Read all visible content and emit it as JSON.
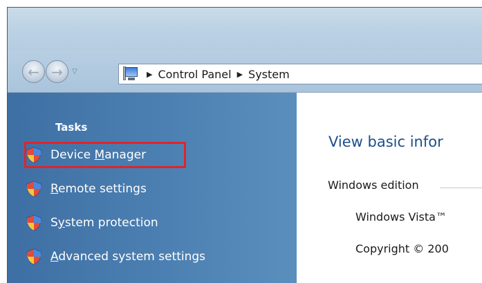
{
  "address_bar": {
    "crumbs": [
      "Control Panel",
      "System"
    ]
  },
  "tasks": {
    "heading": "Tasks",
    "items": [
      {
        "label": "Device Manager",
        "accesskey_before": "Device ",
        "accesskey": "M",
        "accesskey_after": "anager",
        "highlighted": true
      },
      {
        "label": "Remote settings",
        "accesskey_before": "",
        "accesskey": "R",
        "accesskey_after": "emote settings",
        "highlighted": false
      },
      {
        "label": "System protection",
        "accesskey_before": "S",
        "accesskey": "y",
        "accesskey_after": "stem protection",
        "highlighted": false
      },
      {
        "label": "Advanced system settings",
        "accesskey_before": "",
        "accesskey": "A",
        "accesskey_after": "dvanced system settings",
        "highlighted": false
      }
    ]
  },
  "main": {
    "heading": "View basic infor",
    "edition_label": "Windows edition",
    "edition_value": "Windows Vista™",
    "copyright": "Copyright © 200"
  },
  "colors": {
    "highlight_border": "#e2232a",
    "heading_blue": "#1c4f8a",
    "taskpane_blue": "#4c80b2"
  },
  "icons": [
    "back-arrow-icon",
    "forward-arrow-icon",
    "computer-icon",
    "uac-shield-icon"
  ]
}
